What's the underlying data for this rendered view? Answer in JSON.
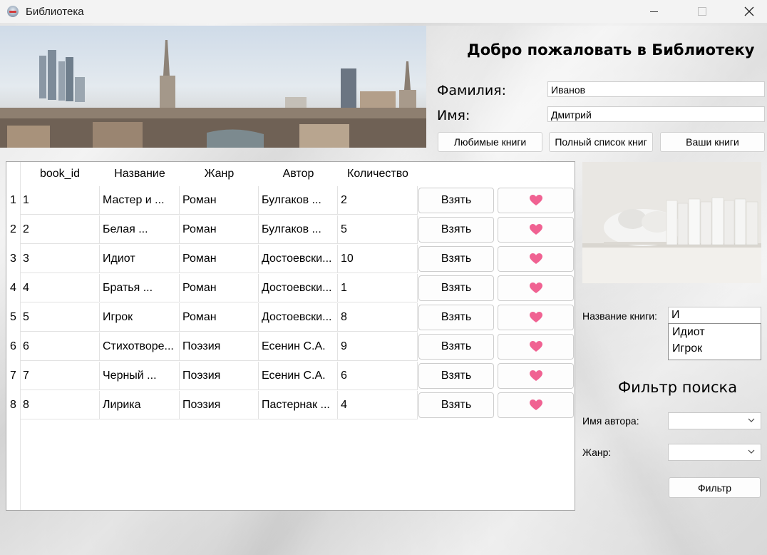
{
  "window": {
    "title": "Библиотека"
  },
  "header": {
    "welcome": "Добро пожаловать в Библиотеку",
    "surname_label": "Фамилия:",
    "surname_value": "Иванов",
    "name_label": "Имя:",
    "name_value": "Дмитрий",
    "buttons": {
      "favorites": "Любимые книги",
      "full_list": "Полный список книг",
      "your_books": "Ваши книги"
    }
  },
  "table": {
    "columns": [
      "book_id",
      "Название",
      "Жанр",
      "Автор",
      "Количество"
    ],
    "take_label": "Взять",
    "rows": [
      {
        "n": "1",
        "id": "1",
        "title": "Мастер и ...",
        "genre": "Роман",
        "author": "Булгаков ...",
        "qty": "2"
      },
      {
        "n": "2",
        "id": "2",
        "title": "Белая ...",
        "genre": "Роман",
        "author": "Булгаков ...",
        "qty": "5"
      },
      {
        "n": "3",
        "id": "3",
        "title": "Идиот",
        "genre": "Роман",
        "author": "Достоевски...",
        "qty": "10"
      },
      {
        "n": "4",
        "id": "4",
        "title": "Братья ...",
        "genre": "Роман",
        "author": "Достоевски...",
        "qty": "1"
      },
      {
        "n": "5",
        "id": "5",
        "title": "Игрок",
        "genre": "Роман",
        "author": "Достоевски...",
        "qty": "8"
      },
      {
        "n": "6",
        "id": "6",
        "title": "Стихотворе...",
        "genre": "Поэзия",
        "author": "Есенин С.А.",
        "qty": "9"
      },
      {
        "n": "7",
        "id": "7",
        "title": "Черный ...",
        "genre": "Поэзия",
        "author": "Есенин С.А.",
        "qty": "6"
      },
      {
        "n": "8",
        "id": "8",
        "title": "Лирика",
        "genre": "Поэзия",
        "author": "Пастернак ...",
        "qty": "4"
      }
    ]
  },
  "search": {
    "label": "Название книги:",
    "value": "И",
    "suggestions": [
      "Идиот",
      "Игрок"
    ]
  },
  "filter": {
    "title": "Фильтр поиска",
    "author_label": "Имя автора:",
    "author_value": "",
    "genre_label": "Жанр:",
    "genre_value": "",
    "button": "Фильтр"
  },
  "colors": {
    "heart": "#f06292",
    "border": "#cdcdcd"
  }
}
